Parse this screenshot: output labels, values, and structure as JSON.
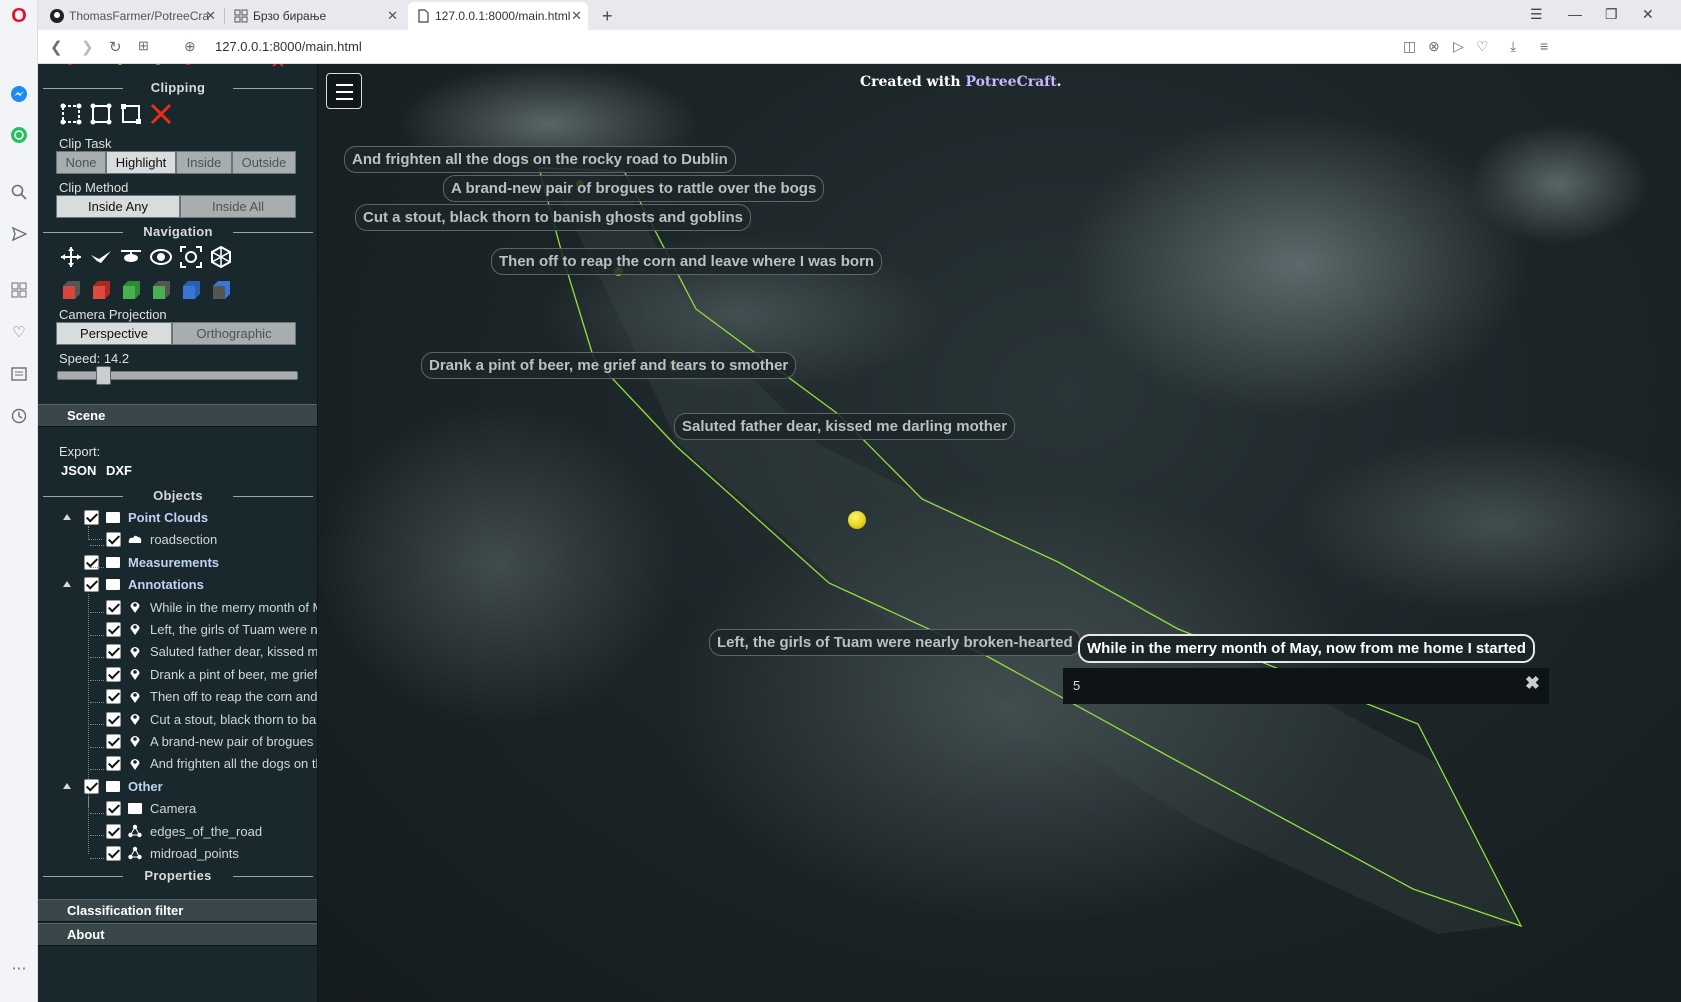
{
  "browser": {
    "tabs": [
      {
        "title": "ThomasFarmer/PotreeCraft",
        "icon": "github-icon"
      },
      {
        "title": "Брзо бирање",
        "icon": "speed-dial-icon"
      },
      {
        "title": "127.0.0.1:8000/main.html",
        "icon": "page-icon",
        "active": true
      }
    ],
    "url": "127.0.0.1:8000/main.html"
  },
  "sidebar": {
    "clipping_title": "Clipping",
    "clip_task_label": "Clip Task",
    "clip_task_options": [
      "None",
      "Highlight",
      "Inside",
      "Outside"
    ],
    "clip_task_selected": "Highlight",
    "clip_method_label": "Clip Method",
    "clip_method_options": [
      "Inside Any",
      "Inside All"
    ],
    "clip_method_selected": "Inside Any",
    "navigation_title": "Navigation",
    "camera_projection_label": "Camera Projection",
    "camera_projection_options": [
      "Perspective",
      "Orthographic"
    ],
    "camera_projection_selected": "Perspective",
    "speed_label": "Speed: 14.2",
    "speed_value": 14.2,
    "scene_title": "Scene",
    "export_label": "Export:",
    "export_json": "JSON",
    "export_dxf": "DXF",
    "objects_title": "Objects",
    "tree": {
      "point_clouds": "Point Clouds",
      "roadsection": "roadsection",
      "measurements": "Measurements",
      "annotations": "Annotations",
      "annotation_items": [
        "While in the merry month of M",
        "Left, the girls of Tuam were ne",
        "Saluted father dear, kissed me",
        "Drank a pint of beer, me grief",
        "Then off to reap the corn and",
        "Cut a stout, black thorn to ban",
        "A brand-new pair of brogues to",
        "And frighten all the dogs on th"
      ],
      "other": "Other",
      "camera": "Camera",
      "edges": "edges_of_the_road",
      "midroad": "midroad_points"
    },
    "properties_title": "Properties",
    "classification_filter": "Classification filter",
    "about": "About"
  },
  "viewer": {
    "created_prefix": "Created with ",
    "created_brand": "PotreeCraft",
    "created_suffix": ".",
    "annotations": [
      "And frighten all the dogs on the rocky road to Dublin",
      "A brand-new pair of brogues to rattle over the bogs",
      "Cut a stout, black thorn to banish ghosts and goblins",
      "Then off to reap the corn and leave where I was born",
      "Drank a pint of beer, me grief and tears to smother",
      "Saluted father dear, kissed me darling mother",
      "Left, the girls of Tuam were nearly broken-hearted",
      "While in the merry month of May, now from me home I started"
    ],
    "annotation_description": "5",
    "close_symbol": "✖",
    "line_color": "#8ee23a",
    "marker_color": "#f2e020"
  }
}
